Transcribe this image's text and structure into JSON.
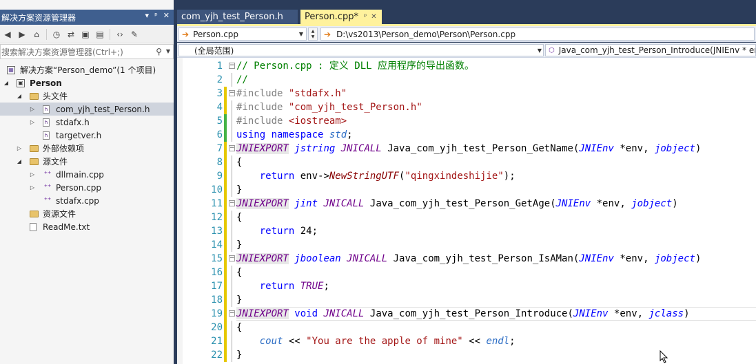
{
  "solution_explorer": {
    "title": "解决方案资源管理器",
    "title_buttons": [
      "▾",
      "ᵖ",
      "✕"
    ],
    "search_placeholder": "搜索解决方案资源管理器(Ctrl+;)",
    "tree": [
      {
        "label": "解决方案“Person_demo”(1 个项目)",
        "icon": "solution-icon",
        "depth": 0,
        "expander": "",
        "selected": false
      },
      {
        "label": "Person",
        "icon": "project-icon",
        "depth": 0,
        "expander": "◢",
        "selected": false,
        "bold": true
      },
      {
        "label": "头文件",
        "icon": "folder-icon",
        "depth": 1,
        "expander": "◢",
        "selected": false
      },
      {
        "label": "com_yjh_test_Person.h",
        "icon": "header-file-icon",
        "depth": 2,
        "expander": "▷",
        "selected": true
      },
      {
        "label": "stdafx.h",
        "icon": "header-file-icon",
        "depth": 2,
        "expander": "▷",
        "selected": false
      },
      {
        "label": "targetver.h",
        "icon": "header-file-icon",
        "depth": 2,
        "expander": "",
        "selected": false
      },
      {
        "label": "外部依赖项",
        "icon": "folder-icon",
        "depth": 1,
        "expander": "▷",
        "selected": false
      },
      {
        "label": "源文件",
        "icon": "folder-icon",
        "depth": 1,
        "expander": "◢",
        "selected": false
      },
      {
        "label": "dllmain.cpp",
        "icon": "cpp-file-icon",
        "depth": 2,
        "expander": "▷",
        "selected": false
      },
      {
        "label": "Person.cpp",
        "icon": "cpp-file-icon",
        "depth": 2,
        "expander": "▷",
        "selected": false
      },
      {
        "label": "stdafx.cpp",
        "icon": "cpp-file-icon",
        "depth": 2,
        "expander": "",
        "selected": false
      },
      {
        "label": "资源文件",
        "icon": "folder-icon",
        "depth": 1,
        "expander": "",
        "selected": false
      },
      {
        "label": "ReadMe.txt",
        "icon": "text-file-icon",
        "depth": 1,
        "expander": "",
        "selected": false
      }
    ]
  },
  "tabs": [
    {
      "label": "com_yjh_test_Person.h",
      "active": false
    },
    {
      "label": "Person.cpp*",
      "active": true
    }
  ],
  "navigation": {
    "file_combo": "Person.cpp",
    "path": "D:\\vs2013\\Person_demo\\Person\\Person.cpp",
    "scope_combo": "(全局范围)",
    "member_combo": "Java_com_yjh_test_Person_Introduce(JNIEnv * env,"
  },
  "code_lines": [
    {
      "n": "1",
      "change": "",
      "tokens": [
        [
          "cm",
          "// Person.cpp : 定义 DLL 应用程序的导出函数。"
        ]
      ]
    },
    {
      "n": "2",
      "change": "",
      "tokens": [
        [
          "cm",
          "//"
        ]
      ]
    },
    {
      "n": "3",
      "change": "y",
      "tokens": [
        [
          "pp",
          "#include "
        ],
        [
          "st",
          "\"stdafx.h\""
        ]
      ]
    },
    {
      "n": "4",
      "change": "y",
      "tokens": [
        [
          "pp",
          "#include "
        ],
        [
          "st",
          "\"com_yjh_test_Person.h\""
        ]
      ]
    },
    {
      "n": "5",
      "change": "g",
      "tokens": [
        [
          "pp",
          "#include "
        ],
        [
          "st",
          "<iostream>"
        ]
      ]
    },
    {
      "n": "6",
      "change": "g",
      "tokens": [
        [
          "kw",
          "using namespace "
        ],
        [
          "pr",
          "std"
        ],
        [
          "nm",
          ";"
        ]
      ]
    },
    {
      "n": "7",
      "change": "y",
      "tokens": [
        [
          "mac",
          "JNIEXPORT"
        ],
        [
          "nm",
          " "
        ],
        [
          "ty",
          "jstring"
        ],
        [
          "nm",
          " "
        ],
        [
          "mac",
          "JNICALL"
        ],
        [
          "nm",
          " Java_com_yjh_test_Person_GetName("
        ],
        [
          "ty",
          "JNIEnv"
        ],
        [
          "nm",
          " *env, "
        ],
        [
          "ty",
          "jobject"
        ],
        [
          "nm",
          ")"
        ]
      ]
    },
    {
      "n": "8",
      "change": "y",
      "tokens": [
        [
          "nm",
          "{"
        ]
      ]
    },
    {
      "n": "9",
      "change": "y",
      "tokens": [
        [
          "nm",
          "    "
        ],
        [
          "kw",
          "return"
        ],
        [
          "nm",
          " env->"
        ],
        [
          "fn",
          "NewStringUTF"
        ],
        [
          "nm",
          "("
        ],
        [
          "st",
          "\"qingxindeshijie\""
        ],
        [
          "nm",
          ");"
        ]
      ]
    },
    {
      "n": "10",
      "change": "y",
      "tokens": [
        [
          "nm",
          "}"
        ]
      ]
    },
    {
      "n": "11",
      "change": "y",
      "tokens": [
        [
          "mac",
          "JNIEXPORT"
        ],
        [
          "nm",
          " "
        ],
        [
          "ty",
          "jint"
        ],
        [
          "nm",
          " "
        ],
        [
          "mac",
          "JNICALL"
        ],
        [
          "nm",
          " Java_com_yjh_test_Person_GetAge("
        ],
        [
          "ty",
          "JNIEnv"
        ],
        [
          "nm",
          " *env, "
        ],
        [
          "ty",
          "jobject"
        ],
        [
          "nm",
          ")"
        ]
      ]
    },
    {
      "n": "12",
      "change": "y",
      "tokens": [
        [
          "nm",
          "{"
        ]
      ]
    },
    {
      "n": "13",
      "change": "y",
      "tokens": [
        [
          "nm",
          "    "
        ],
        [
          "kw",
          "return"
        ],
        [
          "nm",
          " 24;"
        ]
      ]
    },
    {
      "n": "14",
      "change": "y",
      "tokens": [
        [
          "nm",
          "}"
        ]
      ]
    },
    {
      "n": "15",
      "change": "y",
      "tokens": [
        [
          "mac",
          "JNIEXPORT"
        ],
        [
          "nm",
          " "
        ],
        [
          "ty",
          "jboolean"
        ],
        [
          "nm",
          " "
        ],
        [
          "mac",
          "JNICALL"
        ],
        [
          "nm",
          " Java_com_yjh_test_Person_IsAMan("
        ],
        [
          "ty",
          "JNIEnv"
        ],
        [
          "nm",
          " *env, "
        ],
        [
          "ty",
          "jobject"
        ],
        [
          "nm",
          ")"
        ]
      ]
    },
    {
      "n": "16",
      "change": "y",
      "tokens": [
        [
          "nm",
          "{"
        ]
      ]
    },
    {
      "n": "17",
      "change": "y",
      "tokens": [
        [
          "nm",
          "    "
        ],
        [
          "kw",
          "return"
        ],
        [
          "nm",
          " "
        ],
        [
          "mac",
          "TRUE"
        ],
        [
          "nm",
          ";"
        ]
      ]
    },
    {
      "n": "18",
      "change": "y",
      "tokens": [
        [
          "nm",
          "}"
        ]
      ]
    },
    {
      "n": "19",
      "change": "y",
      "tokens": [
        [
          "mac",
          "JNIEXPORT"
        ],
        [
          "nm",
          " "
        ],
        [
          "kw",
          "void"
        ],
        [
          "nm",
          " "
        ],
        [
          "mac",
          "JNICALL"
        ],
        [
          "nm",
          " Java_com_yjh_test_Person_Introduce("
        ],
        [
          "ty",
          "JNIEnv"
        ],
        [
          "nm",
          " *env, "
        ],
        [
          "ty",
          "jclass"
        ],
        [
          "nm",
          ")"
        ]
      ]
    },
    {
      "n": "20",
      "change": "y",
      "tokens": [
        [
          "nm",
          "{"
        ]
      ]
    },
    {
      "n": "21",
      "change": "y",
      "tokens": [
        [
          "nm",
          "    "
        ],
        [
          "pr",
          "cout"
        ],
        [
          "nm",
          " << "
        ],
        [
          "st",
          "\"You are the apple of mine\""
        ],
        [
          "nm",
          " << "
        ],
        [
          "pr",
          "endl"
        ],
        [
          "nm",
          ";"
        ]
      ]
    },
    {
      "n": "22",
      "change": "y",
      "tokens": [
        [
          "nm",
          "}"
        ]
      ]
    }
  ],
  "colors": {
    "title_bar": "#3f5f8f",
    "active_tab": "#fff29d",
    "line_numbers": "#2b91af",
    "change_saved": "#46b346",
    "change_unsaved": "#e6c800"
  }
}
